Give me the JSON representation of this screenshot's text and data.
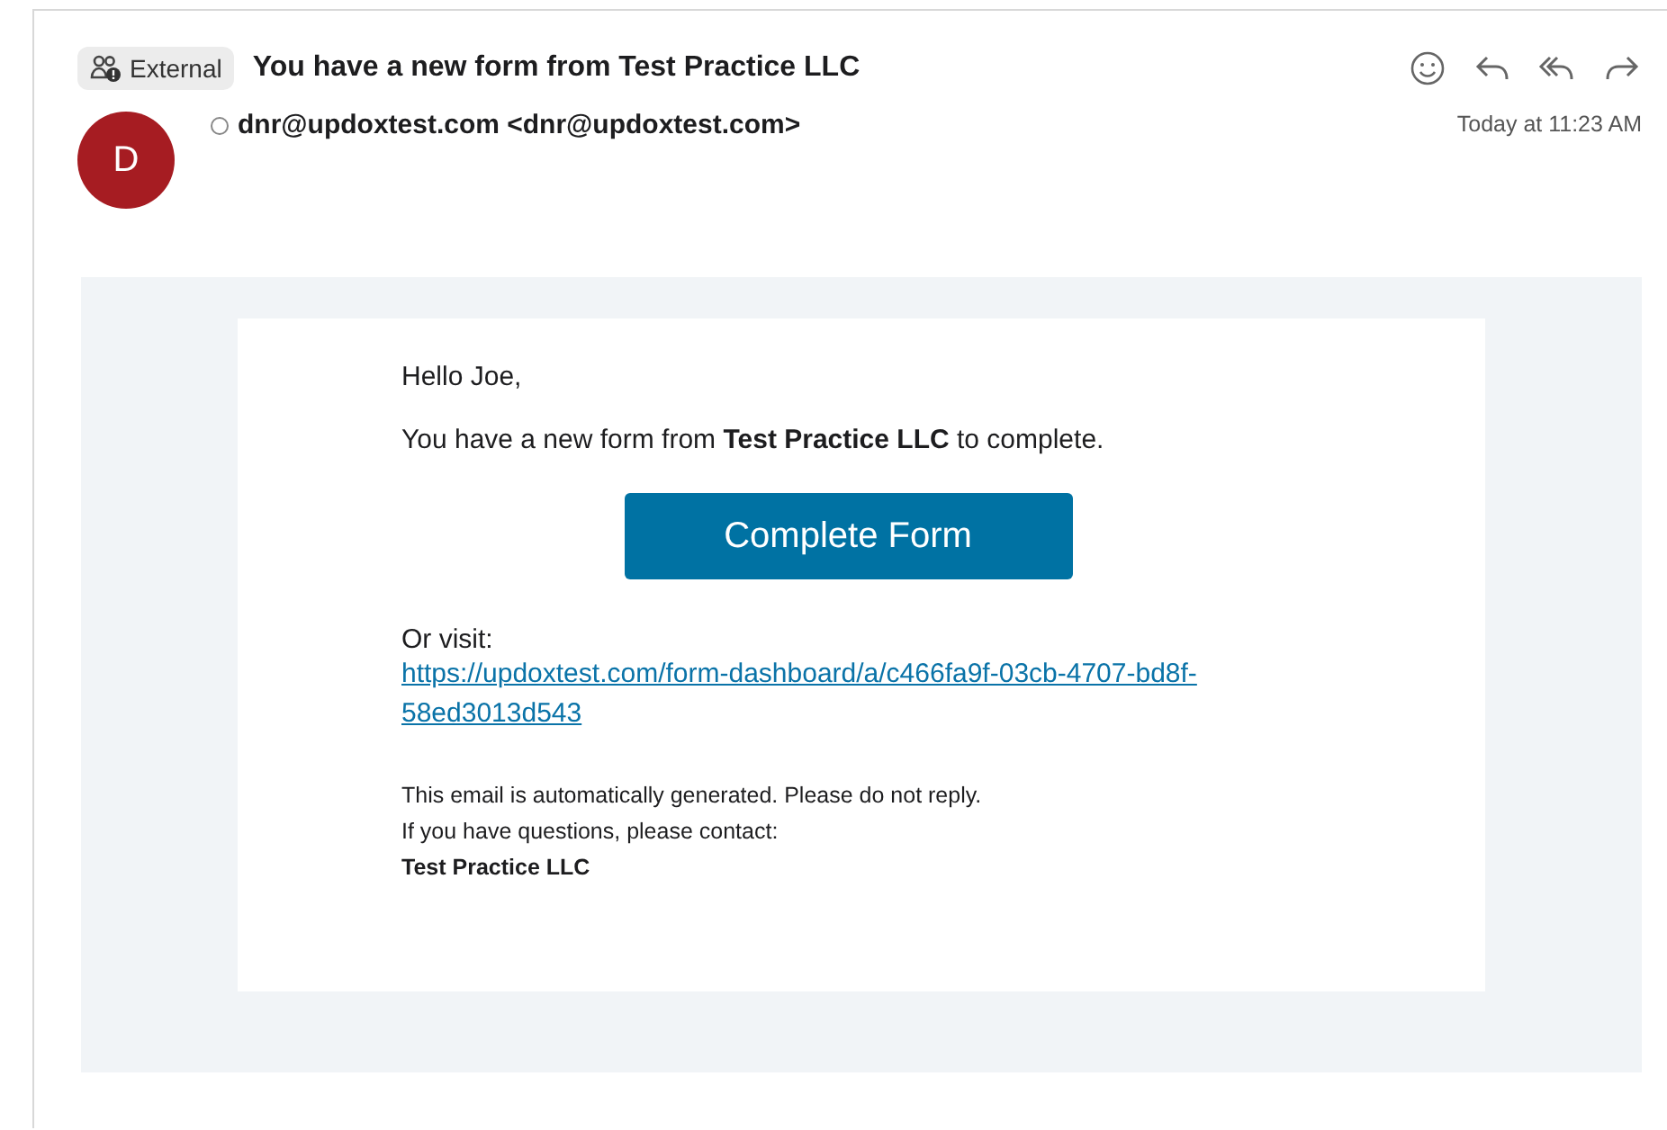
{
  "header": {
    "badge": "External",
    "subject": "You have a new form from Test Practice LLC"
  },
  "sender": {
    "initial": "D",
    "address": "dnr@updoxtest.com <dnr@updoxtest.com>",
    "time": "Today at 11:23 AM"
  },
  "body": {
    "greeting": "Hello Joe,",
    "message": "You have a new form from **Test Practice LLC** to complete.",
    "button": "Complete Form",
    "visit_label": "Or visit:",
    "link": "https://updoxtest.com/form-dashboard/a/c466fa9f-03cb-4707-bd8f-58ed3013d543",
    "footer_lines": [
      "This email is automatically generated. Please do not reply.",
      "If you have questions, please contact:"
    ],
    "footer_company": "Test Practice LLC"
  }
}
